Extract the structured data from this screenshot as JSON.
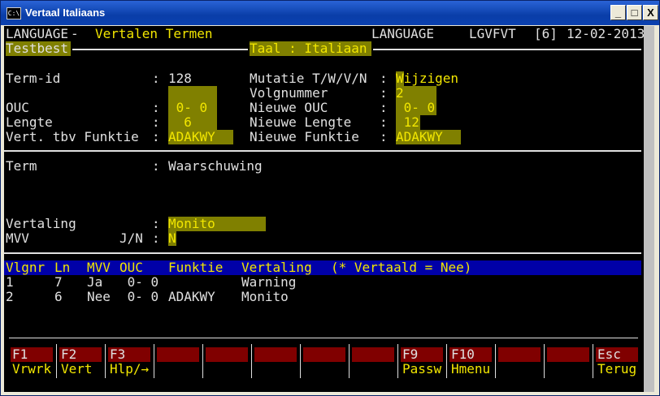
{
  "window": {
    "title": "Vertaal Italiaans",
    "icon_text": "C:\\",
    "btn_min": "_",
    "btn_max": "□",
    "btn_close": "X"
  },
  "header": {
    "app": "LANGUAGE",
    "dash": "-",
    "screen": "Vertalen Termen",
    "app2": "LANGUAGE",
    "prog": "LGVFVT",
    "session": "[6]",
    "date": "12-02-2013"
  },
  "bar2": {
    "left": "Testbest",
    "taal": "Taal : Italiaan"
  },
  "fields": {
    "termid_label": "Term-id",
    "colon": ":",
    "termid_value": "128",
    "ouc_label": "OUC",
    "ouc_value": " 0- 0",
    "lengte_label": "Lengte",
    "lengte_value": "  6",
    "vert_label": "Vert. tbv Funktie",
    "vert_value": "ADAKWY",
    "mutatie_label": "Mutatie T/W/V/N",
    "mutatie_value": "Wijzigen",
    "volg_label": "Volgnummer",
    "volg_value": "2",
    "nouc_label": "Nieuwe OUC",
    "nouc_value": " 0- 0",
    "nlengte_label": "Nieuwe Lengte",
    "nlengte_value": " 12",
    "nfunk_label": "Nieuwe Funktie",
    "nfunk_value": "ADAKWY",
    "term_label": "Term",
    "term_value": "Waarschuwing",
    "vertaling_label": "Vertaling",
    "vertaling_value": "Monito",
    "mvv_label": "MVV",
    "jn_label": "J/N",
    "mvv_value": "N"
  },
  "table": {
    "headers": [
      "Vlgnr",
      "Ln",
      "MVV",
      "OUC",
      "Funktie",
      "Vertaling",
      "(* Vertaald = Nee)"
    ],
    "rows": [
      [
        "1",
        "7",
        "Ja",
        " 0- 0",
        "",
        "Warning"
      ],
      [
        "2",
        "6",
        "Nee",
        " 0- 0",
        "ADAKWY",
        "Monito"
      ]
    ]
  },
  "fkeys": [
    {
      "key": "F1",
      "label": "Vrwrk"
    },
    {
      "key": "F2",
      "label": "Vert"
    },
    {
      "key": "F3",
      "label": "Hlp/→"
    },
    {
      "key": "",
      "label": ""
    },
    {
      "key": "",
      "label": ""
    },
    {
      "key": "",
      "label": ""
    },
    {
      "key": "",
      "label": ""
    },
    {
      "key": "",
      "label": ""
    },
    {
      "key": "F9",
      "label": "Passw"
    },
    {
      "key": "F10",
      "label": "Hmenu"
    },
    {
      "key": "",
      "label": ""
    },
    {
      "key": "",
      "label": ""
    },
    {
      "key": "Esc",
      "label": "Terug"
    }
  ]
}
